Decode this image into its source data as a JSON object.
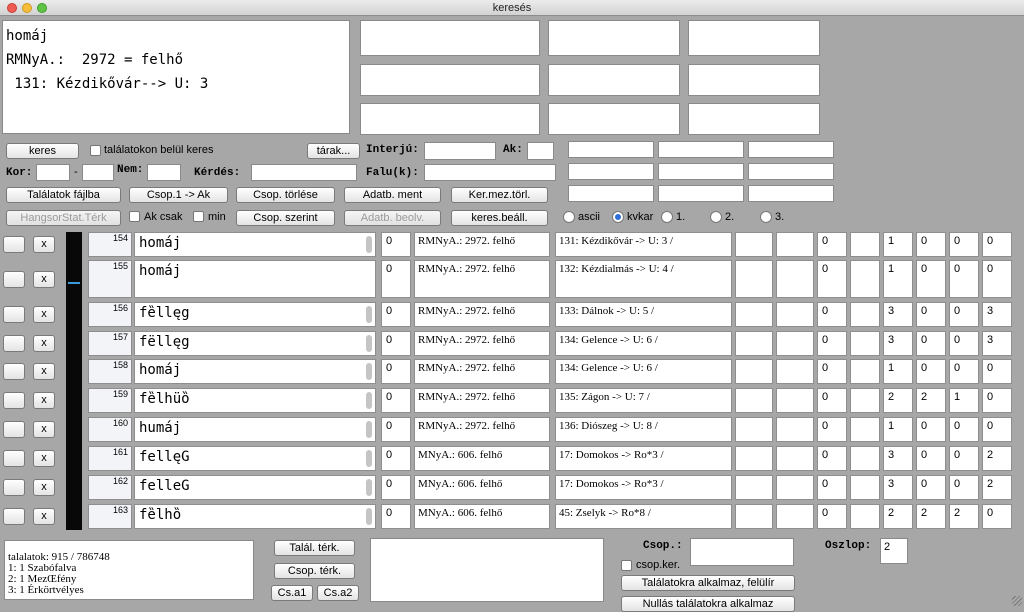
{
  "window": {
    "title": "keresés"
  },
  "main_display": {
    "line1": "homáj",
    "line2": "RMNyA.:  2972 = felhő",
    "line3": " 131: Kézdikővár--> U: 3"
  },
  "controls": {
    "keres": "keres",
    "talalatokon_belul": "találatokon belül keres",
    "tarak": "tárak...",
    "interju": "Interjú:",
    "ak": "Ak:",
    "kor": "Kor:",
    "kor_dash": "-",
    "nem": "Nem:",
    "kerdes": "Kérdés:",
    "falu": "Falu(k):",
    "talalatok_fajlba": "Találatok fájlba",
    "csop1_ak": "Csop.1 -> Ak",
    "csop_torlese": "Csop. törlése",
    "adatb_ment": "Adatb. ment",
    "ker_mez_torl": "Ker.mez.törl.",
    "hangsorstat_terk": "HangsorStat.Térk",
    "ak_csak": "Ak csak",
    "min": "min",
    "csop_szerint": "Csop. szerint",
    "adatb_beolv": "Adatb. beolv.",
    "keres_beall": "keres.beáll.",
    "radio_ascii": "ascii",
    "radio_kvkar": "kvkar",
    "radio_1": "1.",
    "radio_2": "2.",
    "radio_3": "3.",
    "row_x": "x"
  },
  "rows": [
    {
      "id": "154",
      "word": "homáj",
      "n0": "0",
      "source": "RMNyA.:  2972. felhő",
      "place": "131: Kézdikővár -> U: 3 /",
      "v1": "0",
      "v2": "1",
      "v3": "0",
      "v4": "0",
      "v5": "0"
    },
    {
      "id": "155",
      "word": "homáj",
      "n0": "0",
      "source": "RMNyA.:  2972. felhő",
      "place": "132: Kézdialmás -> U: 4 /",
      "v1": "0",
      "v2": "1",
      "v3": "0",
      "v4": "0",
      "v5": "0"
    },
    {
      "id": "156",
      "word": "fȅllęg",
      "n0": "0",
      "source": "RMNyA.:  2972. felhő",
      "place": "133: Dálnok -> U: 5 /",
      "v1": "0",
      "v2": "3",
      "v3": "0",
      "v4": "0",
      "v5": "3"
    },
    {
      "id": "157",
      "word": "fëllęg",
      "n0": "0",
      "source": "RMNyA.:  2972. felhő",
      "place": "134: Gelence -> U: 6 /",
      "v1": "0",
      "v2": "3",
      "v3": "0",
      "v4": "0",
      "v5": "3"
    },
    {
      "id": "158",
      "word": "homáj",
      "n0": "0",
      "source": "RMNyA.:  2972. felhő",
      "place": "134: Gelence -> U: 6 /",
      "v1": "0",
      "v2": "1",
      "v3": "0",
      "v4": "0",
      "v5": "0"
    },
    {
      "id": "159",
      "word": "fȅlhüȍ",
      "n0": "0",
      "source": "RMNyA.:  2972. felhő",
      "place": "135: Zágon -> U: 7 /",
      "v1": "0",
      "v2": "2",
      "v3": "2",
      "v4": "1",
      "v5": "0"
    },
    {
      "id": "160",
      "word": "humáj",
      "n0": "0",
      "source": "RMNyA.:  2972. felhő",
      "place": "136: Diószeg -> U: 8 /",
      "v1": "0",
      "v2": "1",
      "v3": "0",
      "v4": "0",
      "v5": "0"
    },
    {
      "id": "161",
      "word": "fellęG",
      "n0": "0",
      "source": "MNyA.:  606. felhő",
      "place": "17: Domokos -> Ro*3 /",
      "v1": "0",
      "v2": "3",
      "v3": "0",
      "v4": "0",
      "v5": "2"
    },
    {
      "id": "162",
      "word": "felleG",
      "n0": "0",
      "source": "MNyA.:  606. felhő",
      "place": "17: Domokos -> Ro*3 /",
      "v1": "0",
      "v2": "3",
      "v3": "0",
      "v4": "0",
      "v5": "2"
    },
    {
      "id": "163",
      "word": "fȅlhȍ",
      "n0": "0",
      "source": "MNyA.:  606. felhő",
      "place": "45: Zselyk -> Ro*8 /",
      "v1": "0",
      "v2": "2",
      "v3": "2",
      "v4": "2",
      "v5": "0"
    }
  ],
  "bottom": {
    "results": [
      "talalatok: 915 / 786748",
      "1: 1    Szabófalva",
      "2: 1    MezŒfény",
      "3: 1    Érkörtvélyes"
    ],
    "talal_terk": "Talál. térk.",
    "csop_terk": "Csop. térk.",
    "csa1": "Cs.a1",
    "csa2": "Cs.a2",
    "csop_label": "Csop.:",
    "csop_ker": "csop.ker.",
    "alkalmaz_felulir": "Találatokra alkalmaz, felülír",
    "nullas_alkalmaz": "Nullás találatokra alkalmaz",
    "oszlop_label": "Oszlop:",
    "oszlop_value": "2"
  }
}
